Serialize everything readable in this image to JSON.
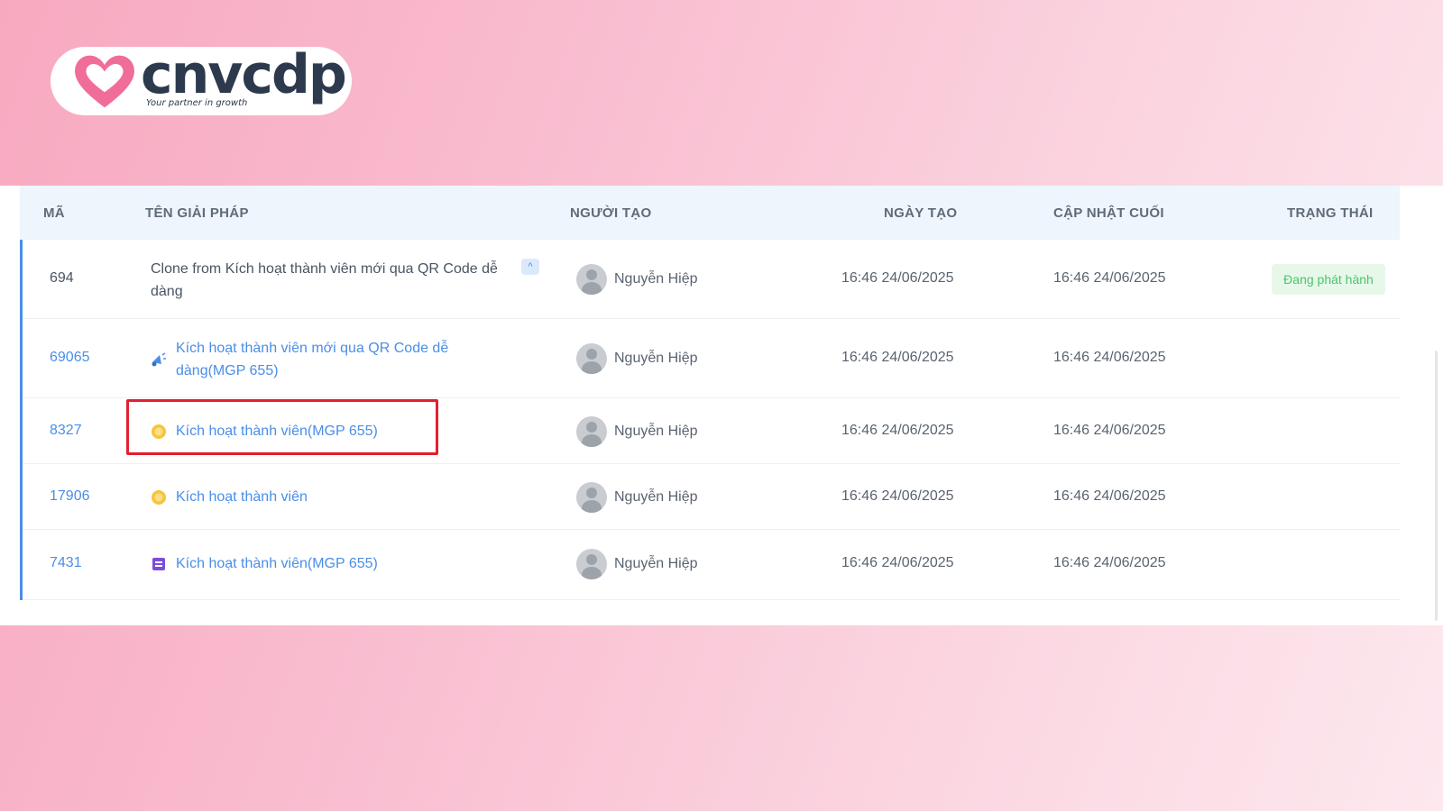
{
  "logo": {
    "word": "cnvcdp",
    "tagline": "Your partner in growth",
    "heart_color": "#f06d9a"
  },
  "table": {
    "headers": {
      "code": "MÃ",
      "name": "TÊN GIẢI PHÁP",
      "creator": "NGƯỜI TẠO",
      "created": "NGÀY TẠO",
      "updated": "CẬP NHẬT CUỐI",
      "status": "TRẠNG THÁI"
    },
    "rows": [
      {
        "code": "694",
        "name": "Clone from Kích hoạt thành viên mới qua QR Code dễ dàng",
        "creator": "Nguyễn Hiệp",
        "created": "16:46 24/06/2025",
        "updated": "16:46 24/06/2025",
        "status": "Đang phát hành",
        "collapse": "^"
      },
      {
        "code": "69065",
        "name": "Kích hoạt thành viên mới qua QR Code dễ dàng(MGP 655)",
        "icon": "megaphone-icon",
        "creator": "Nguyễn Hiệp",
        "created": "16:46 24/06/2025",
        "updated": "16:46 24/06/2025"
      },
      {
        "code": "8327",
        "name": "Kích hoạt thành viên(MGP 655)",
        "icon": "coin-icon",
        "creator": "Nguyễn Hiệp",
        "created": "16:46 24/06/2025",
        "updated": "16:46 24/06/2025"
      },
      {
        "code": "17906",
        "name": "Kích hoạt thành viên",
        "icon": "coin-icon",
        "creator": "Nguyễn Hiệp",
        "created": "16:46 24/06/2025",
        "updated": "16:46 24/06/2025"
      },
      {
        "code": "7431",
        "name": "Kích hoạt thành viên(MGP 655)",
        "icon": "voucher-icon",
        "creator": "Nguyễn Hiệp",
        "created": "16:46 24/06/2025",
        "updated": "16:46 24/06/2025"
      }
    ]
  },
  "colors": {
    "link": "#4a8ee8",
    "status_green": "#4cc46b",
    "highlight": "#e0202e"
  }
}
